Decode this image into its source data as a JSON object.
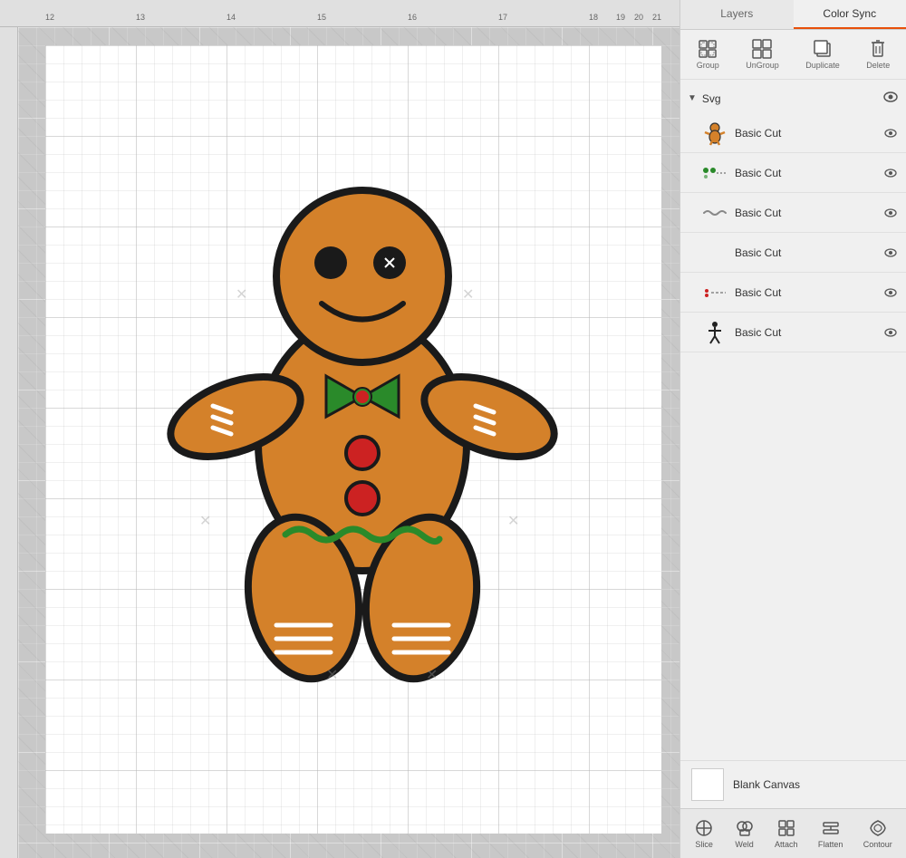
{
  "tabs": {
    "layers_label": "Layers",
    "color_sync_label": "Color Sync"
  },
  "toolbar": {
    "group_label": "Group",
    "ungroup_label": "UnGroup",
    "duplicate_label": "Duplicate",
    "delete_label": "Delete"
  },
  "layers": {
    "svg_label": "Svg",
    "items": [
      {
        "id": 1,
        "label": "Basic Cut",
        "thumb_type": "gingerbread",
        "visible": true
      },
      {
        "id": 2,
        "label": "Basic Cut",
        "thumb_type": "green_dots",
        "visible": true
      },
      {
        "id": 3,
        "label": "Basic Cut",
        "thumb_type": "wavy",
        "visible": true
      },
      {
        "id": 4,
        "label": "Basic Cut",
        "thumb_type": "none",
        "visible": true
      },
      {
        "id": 5,
        "label": "Basic Cut",
        "thumb_type": "dots_line",
        "visible": true
      },
      {
        "id": 6,
        "label": "Basic Cut",
        "thumb_type": "stick_figure",
        "visible": true
      }
    ]
  },
  "blank_canvas": {
    "label": "Blank Canvas"
  },
  "bottom_toolbar": {
    "slice_label": "Slice",
    "weld_label": "Weld",
    "attach_label": "Attach",
    "flatten_label": "Flatten",
    "contour_label": "Contour"
  },
  "ruler": {
    "ticks": [
      "12",
      "13",
      "14",
      "15",
      "16",
      "17",
      "18",
      "19",
      "20",
      "21"
    ]
  },
  "colors": {
    "active_tab_underline": "#e8500a",
    "gingerbread_body": "#d4812a",
    "gingerbread_outline": "#1a1a1a"
  }
}
